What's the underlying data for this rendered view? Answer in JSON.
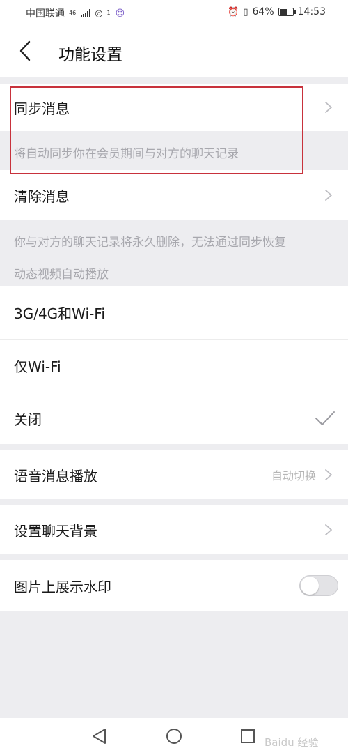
{
  "status_bar": {
    "carrier": "中国联通",
    "network_tag": "46",
    "hotspot_count": "1",
    "battery_percent": "64%",
    "battery_level": 0.64,
    "time": "14:53"
  },
  "header": {
    "title": "功能设置"
  },
  "sync": {
    "label": "同步消息",
    "desc": "将自动同步你在会员期间与对方的聊天记录"
  },
  "clear": {
    "label": "清除消息",
    "desc_line1": "你与对方的聊天记录将永久删除，无法通过同步恢复",
    "desc_line2": "动态视频自动播放"
  },
  "autoplay_options": [
    {
      "label": "3G/4G和Wi-Fi",
      "selected": false
    },
    {
      "label": "仅Wi-Fi",
      "selected": false
    },
    {
      "label": "关闭",
      "selected": true
    }
  ],
  "voice": {
    "label": "语音消息播放",
    "value": "自动切换"
  },
  "background": {
    "label": "设置聊天背景"
  },
  "watermark_setting": {
    "label": "图片上展示水印",
    "enabled": false
  },
  "colors": {
    "highlight_border": "#c8323c",
    "page_bg": "#ededf0",
    "secondary_text": "#a8a8ae"
  },
  "nav_watermark": "Baidu 经验"
}
